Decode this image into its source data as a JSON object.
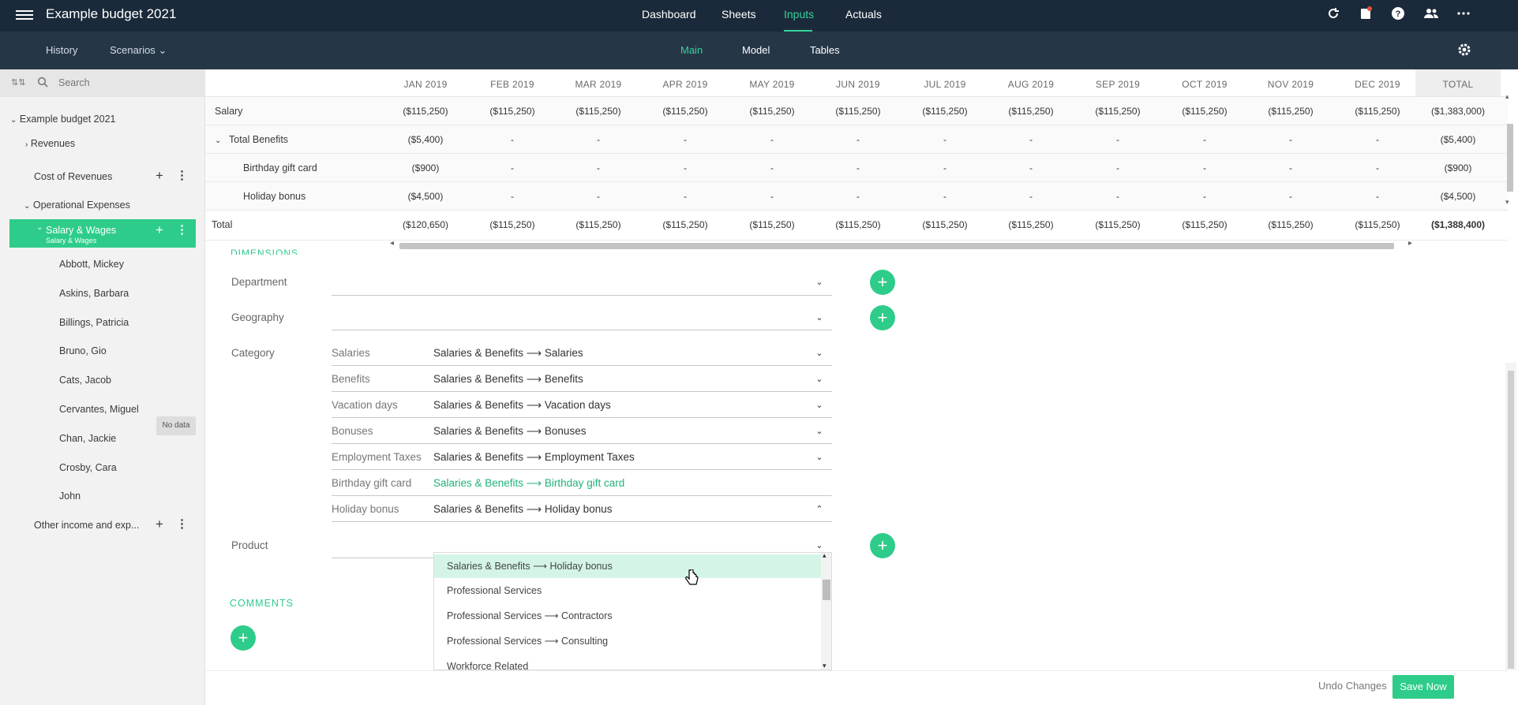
{
  "app": {
    "title": "Example budget 2021"
  },
  "topnav": {
    "tabs": [
      "Dashboard",
      "Sheets",
      "Inputs",
      "Actuals"
    ],
    "active": "Inputs"
  },
  "subnav": {
    "left": [
      "History",
      "Scenarios"
    ],
    "tabs": [
      "Main",
      "Model",
      "Tables"
    ],
    "active": "Main"
  },
  "sidebar": {
    "search_placeholder": "Search",
    "items": [
      {
        "label": "Example budget 2021"
      },
      {
        "label": "Revenues"
      },
      {
        "label": "Cost of Revenues"
      },
      {
        "label": "Operational Expenses"
      },
      {
        "label": "Salary & Wages",
        "sublabel": "Salary & Wages"
      },
      {
        "label": "Abbott, Mickey"
      },
      {
        "label": "Askins, Barbara"
      },
      {
        "label": "Billings, Patricia"
      },
      {
        "label": "Bruno, Gio"
      },
      {
        "label": "Cats, Jacob"
      },
      {
        "label": "Cervantes, Miguel"
      },
      {
        "label": "Chan, Jackie"
      },
      {
        "label": "Crosby, Cara"
      },
      {
        "label": "John"
      },
      {
        "label": "Other income and exp..."
      }
    ],
    "no_data_label": "No data"
  },
  "grid": {
    "columns": [
      "JAN 2019",
      "FEB 2019",
      "MAR 2019",
      "APR 2019",
      "MAY 2019",
      "JUN 2019",
      "JUL 2019",
      "AUG 2019",
      "SEP 2019",
      "OCT 2019",
      "NOV 2019",
      "DEC 2019",
      "TOTAL"
    ],
    "rows": [
      {
        "label": "Salary",
        "values": [
          "($115,250)",
          "($115,250)",
          "($115,250)",
          "($115,250)",
          "($115,250)",
          "($115,250)",
          "($115,250)",
          "($115,250)",
          "($115,250)",
          "($115,250)",
          "($115,250)",
          "($115,250)",
          "($1,383,000)"
        ]
      },
      {
        "label": "Total Benefits",
        "values": [
          "($5,400)",
          "-",
          "-",
          "-",
          "-",
          "-",
          "-",
          "-",
          "-",
          "-",
          "-",
          "-",
          "($5,400)"
        ]
      },
      {
        "label": "Birthday gift card",
        "values": [
          "($900)",
          "-",
          "-",
          "-",
          "-",
          "-",
          "-",
          "-",
          "-",
          "-",
          "-",
          "-",
          "($900)"
        ]
      },
      {
        "label": "Holiday bonus",
        "values": [
          "($4,500)",
          "-",
          "-",
          "-",
          "-",
          "-",
          "-",
          "-",
          "-",
          "-",
          "-",
          "-",
          "($4,500)"
        ]
      },
      {
        "label": "Total",
        "values": [
          "($120,650)",
          "($115,250)",
          "($115,250)",
          "($115,250)",
          "($115,250)",
          "($115,250)",
          "($115,250)",
          "($115,250)",
          "($115,250)",
          "($115,250)",
          "($115,250)",
          "($115,250)",
          "($1,388,400)"
        ]
      }
    ]
  },
  "dimensions": {
    "section_label": "DIMENSIONS",
    "department_label": "Department",
    "geography_label": "Geography",
    "category_label": "Category",
    "product_label": "Product",
    "categories": [
      {
        "name": "Salaries",
        "value": "Salaries & Benefits ⟶ Salaries"
      },
      {
        "name": "Benefits",
        "value": "Salaries & Benefits ⟶ Benefits"
      },
      {
        "name": "Vacation days",
        "value": "Salaries & Benefits ⟶ Vacation days"
      },
      {
        "name": "Bonuses",
        "value": "Salaries & Benefits ⟶ Bonuses"
      },
      {
        "name": "Employment Taxes",
        "value": "Salaries & Benefits ⟶ Employment Taxes"
      },
      {
        "name": "Birthday gift card",
        "value": "Salaries & Benefits ⟶ Birthday gift card"
      },
      {
        "name": "Holiday bonus",
        "value": "Salaries & Benefits ⟶ Holiday bonus"
      }
    ]
  },
  "dropdown": {
    "options": [
      "Salaries & Benefits ⟶ Holiday bonus",
      "Professional Services",
      "Professional Services ⟶ Contractors",
      "Professional Services ⟶ Consulting",
      "Workforce Related"
    ]
  },
  "comments": {
    "label": "COMMENTS"
  },
  "footer": {
    "undo": "Undo Changes",
    "save": "Save Now"
  },
  "colors": {
    "accent": "#2ecc8a",
    "topbar": "#1b2a3a",
    "subbar": "#253647"
  }
}
